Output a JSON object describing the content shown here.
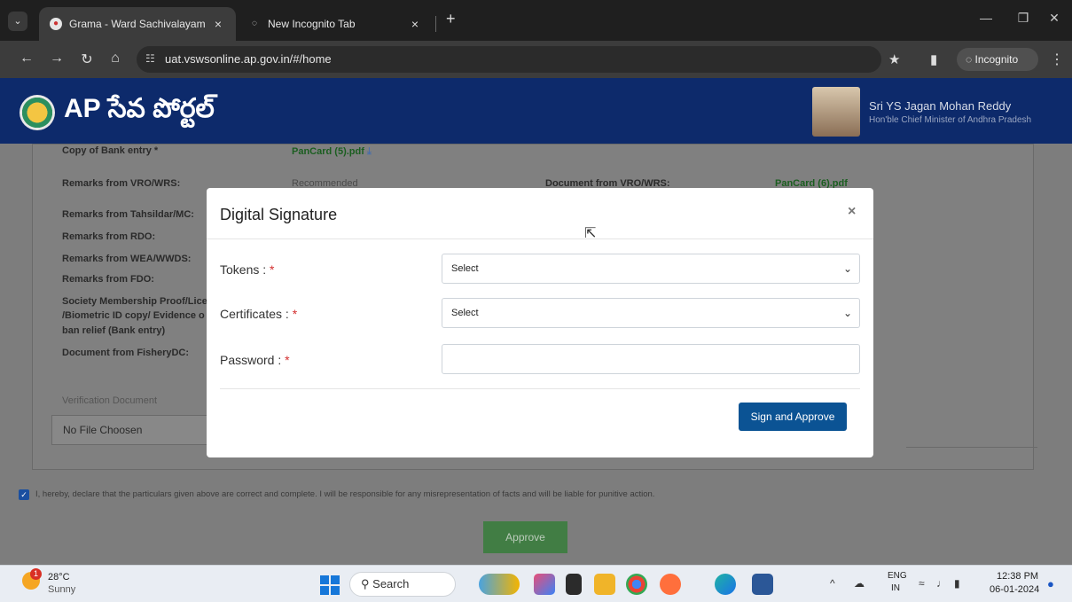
{
  "browser": {
    "tabs": [
      {
        "label": "Grama - Ward Sachivalayam",
        "close": "×"
      },
      {
        "label": "New Incognito Tab",
        "close": "×"
      }
    ],
    "new_tab": "+",
    "url": "uat.vswsonline.ap.gov.in/#/home",
    "incognito_label": "Incognito"
  },
  "portal": {
    "title": "AP సేవ పోర్టల్",
    "cm_name": "Sri YS Jagan Mohan Reddy",
    "cm_role": "Hon'ble Chief Minister of Andhra Pradesh"
  },
  "form": {
    "rows": [
      {
        "label": "Copy of Bank entry *",
        "value": "PanCard (5).pdf"
      },
      {
        "label": "Remarks from VRO/WRS:",
        "value": "Recommended"
      },
      {
        "label": "Remarks from Tahsildar/MC:"
      },
      {
        "label": "Remarks from RDO:"
      },
      {
        "label": "Remarks from WEA/WWDS:"
      },
      {
        "label": "Remarks from FDO:"
      },
      {
        "label": "Society Membership Proof/Lice"
      },
      {
        "label": "/Biometric ID copy/ Evidence o"
      },
      {
        "label": "ban relief (Bank entry)"
      },
      {
        "label": "Document from FisheryDC:"
      }
    ],
    "doc_vro_label": "Document from VRO/WRS:",
    "doc_vro_value": "PanCard (6).pdf",
    "verification_label": "Verification Document",
    "file_placeholder": "No File Choosen",
    "declaration": "I, hereby, declare that the particulars given above are correct and complete. I will be responsible for any misrepresentation of facts and will be liable for punitive action.",
    "approve_label": "Approve"
  },
  "modal": {
    "title": "Digital Signature",
    "close": "×",
    "tokens_label": "Tokens :",
    "tokens_value": "Select",
    "certificates_label": "Certificates :",
    "certificates_value": "Select",
    "password_label": "Password :",
    "required_mark": "*",
    "sign_label": "Sign and Approve"
  },
  "taskbar": {
    "temp": "28°C",
    "weather": "Sunny",
    "weather_badge": "1",
    "search": "Search",
    "lang1": "ENG",
    "lang2": "IN",
    "time": "12:38 PM",
    "date": "06-01-2024"
  },
  "colors": {
    "header_bg": "#0d2a6b",
    "primary_button": "#0b5394",
    "approve_button": "#2e7d32",
    "required": "#d32f2f"
  }
}
